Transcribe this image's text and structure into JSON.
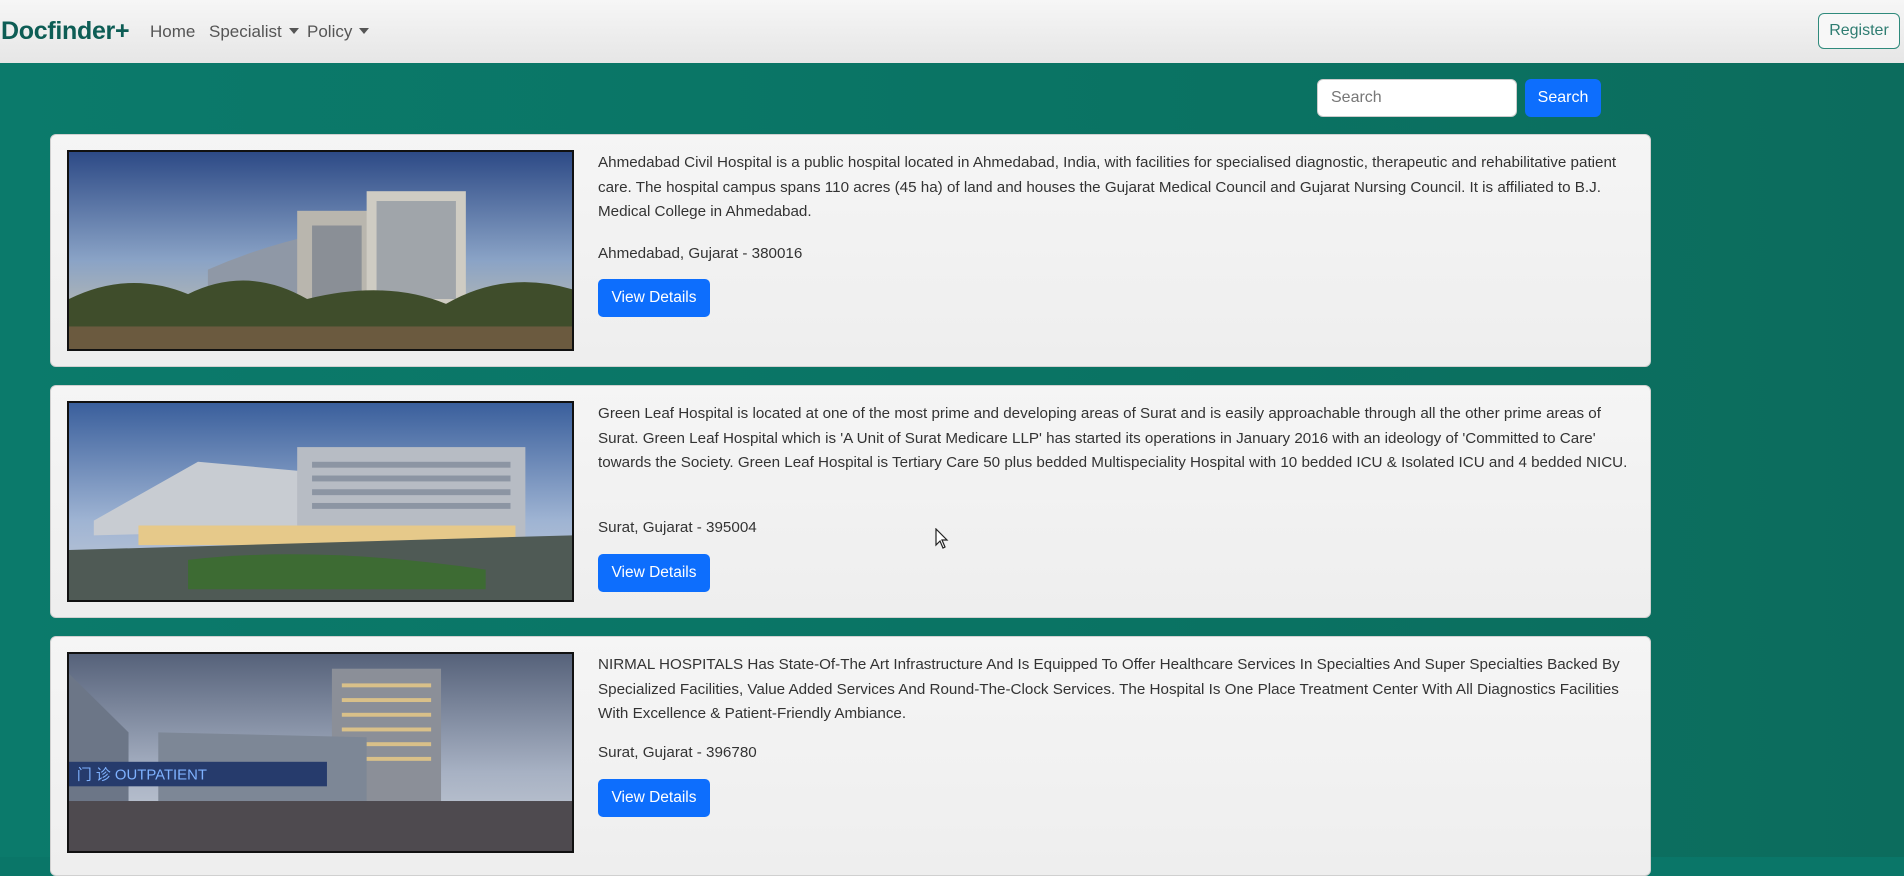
{
  "navbar": {
    "brand": "Docfinder+",
    "links": [
      {
        "label": "Home"
      },
      {
        "label": "Specialist",
        "dropdown": true
      },
      {
        "label": "Policy",
        "dropdown": true
      }
    ],
    "register_label": "Register"
  },
  "search": {
    "placeholder": "Search",
    "value": "",
    "button_label": "Search"
  },
  "hospitals": [
    {
      "description": "Ahmedabad Civil Hospital is a public hospital located in Ahmedabad, India, with facilities for specialised diagnostic, therapeutic and rehabilitative patient care. The hospital campus spans 110 acres (45 ha) of land and houses the Gujarat Medical Council and Gujarat Nursing Council. It is affiliated to B.J. Medical College in Ahmedabad.",
      "location": "Ahmedabad, Gujarat - 380016",
      "button_label": "View Details"
    },
    {
      "description": "Green Leaf Hospital is located at one of the most prime and developing areas of Surat and is easily approachable through all the other prime areas of Surat. Green Leaf Hospital which is 'A Unit of Surat Medicare LLP' has started its operations in January 2016 with an ideology of 'Committed to Care' towards the Society. Green Leaf Hospital is Tertiary Care 50 plus bedded Multispeciality Hospital with 10 bedded ICU & Isolated ICU and 4 bedded NICU.",
      "location": "Surat, Gujarat - 395004",
      "button_label": "View Details"
    },
    {
      "description": "NIRMAL HOSPITALS Has State-Of-The Art Infrastructure And Is Equipped To Offer Healthcare Services In Specialties And Super Specialties Backed By Specialized Facilities, Value Added Services And Round-The-Clock Services. The Hospital Is One Place Treatment Center With All Diagnostics Facilities With Excellence & Patient-Friendly Ambiance.",
      "location": "Surat, Gujarat - 396780",
      "button_label": "View Details",
      "image_signage": "门 诊 OUTPATIENT"
    }
  ],
  "colors": {
    "brand": "#0d5d55",
    "page_background": "#0a7668",
    "primary_button": "#0d6efd"
  }
}
